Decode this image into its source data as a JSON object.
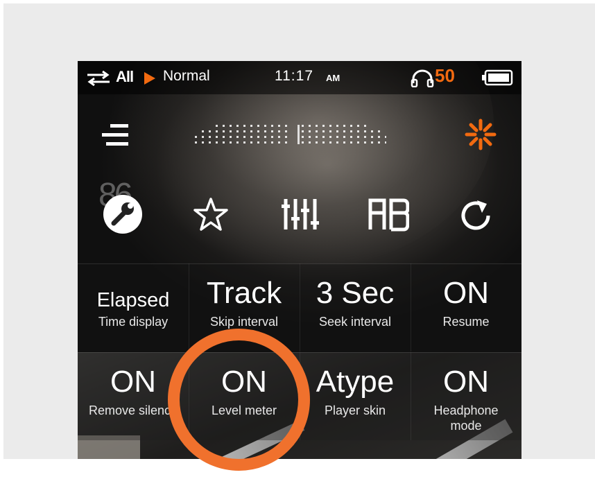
{
  "status_bar": {
    "repeat_label": "All",
    "play_mode": "Normal",
    "time": "11:17",
    "ampm": "AM",
    "volume": "50",
    "icons": [
      "repeat-icon",
      "play-icon",
      "headphone-icon",
      "battery-icon"
    ]
  },
  "toolbar": {
    "icons": [
      "menu-icon",
      "level-meter-dots",
      "settings-close-icon"
    ]
  },
  "quick_icons": {
    "ghost_number": "86",
    "items": [
      "wrench-icon",
      "star-icon",
      "equalizer-icon",
      "ab-repeat-icon",
      "refresh-icon"
    ]
  },
  "settings": [
    {
      "value": "Elapsed",
      "label": "Time display"
    },
    {
      "value": "Track",
      "label": "Skip interval"
    },
    {
      "value": "3 Sec",
      "label": "Seek interval"
    },
    {
      "value": "ON",
      "label": "Resume"
    },
    {
      "value": "ON",
      "label": "Remove silence"
    },
    {
      "value": "ON",
      "label": "Level meter"
    },
    {
      "value": "Atype",
      "label": "Player skin"
    },
    {
      "value": "ON",
      "label": "Headphone mode"
    }
  ],
  "colors": {
    "accent": "#f26a10",
    "highlight_ring": "#f0712d",
    "text": "#ffffff"
  }
}
